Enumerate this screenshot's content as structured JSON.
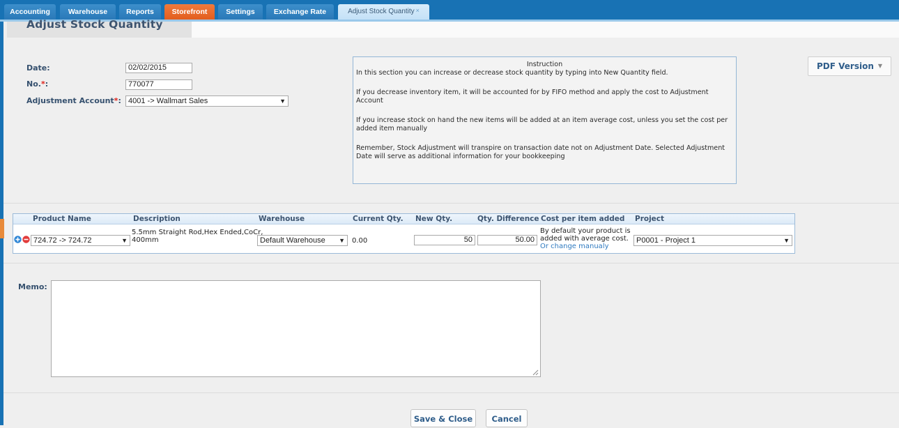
{
  "tabs": [
    {
      "label": "Accounting"
    },
    {
      "label": "Warehouse"
    },
    {
      "label": "Reports"
    },
    {
      "label": "Storefront"
    },
    {
      "label": "Settings"
    },
    {
      "label": "Exchange Rate"
    },
    {
      "label": "Adjust Stock Quantity",
      "close": "×"
    }
  ],
  "page": {
    "title": "Adjust Stock Quantity"
  },
  "form": {
    "date_label": "Date:",
    "date_value": "02/02/2015",
    "no_label": "No.",
    "no_value": "770077",
    "account_label": "Adjustment Account",
    "account_value": "4001 -> Wallmart Sales",
    "required_mark": "*",
    "colon": ":"
  },
  "instruction": {
    "title": "Instruction",
    "paragraphs": [
      "In this section you can increase or decrease stock quantity by typing into New Quantity field.",
      "If you decrease inventory item, it will be accounted for by FIFO method and apply the cost to Adjustment Account",
      "If you increase stock on hand the new items will be added at an item average cost, unless you set the cost per added item manually",
      "Remember, Stock Adjustment will transpire on transaction date not on Adjustment Date. Selected Adjustment Date will serve as additional information for your bookkeeping"
    ]
  },
  "pdf_button": {
    "label": "PDF Version"
  },
  "grid": {
    "headers": {
      "product": "Product Name",
      "description": "Description",
      "warehouse": "Warehouse",
      "current_qty": "Current Qty.",
      "new_qty": "New Qty.",
      "qty_diff": "Qty. Difference",
      "cost": "Cost per item added",
      "project": "Project"
    },
    "row": {
      "product": "724.72 -> 724.72",
      "description_line1": "5.5mm Straight Rod,Hex Ended,CoCr,",
      "description_line2": "400mm",
      "warehouse": "Default Warehouse",
      "current_qty": "0.00",
      "new_qty": "50",
      "qty_diff": "50.00",
      "cost_line1": "By default your product is",
      "cost_line2": "added with average cost.",
      "cost_link": "Or change manualy",
      "project": "P0001 - Project 1"
    }
  },
  "memo": {
    "label": "Memo:",
    "value": ""
  },
  "buttons": {
    "save": "Save & Close",
    "cancel": "Cancel"
  },
  "colors": {
    "tabbar": "#1872b4",
    "storefront_tab": "#e25e1e",
    "label": "#35506e",
    "required": "#e0231c",
    "link": "#2f7ac0"
  },
  "icons": {
    "add_row": "plus-circle-icon",
    "remove_row": "minus-circle-icon",
    "dropdown": "triangle-down-icon"
  }
}
